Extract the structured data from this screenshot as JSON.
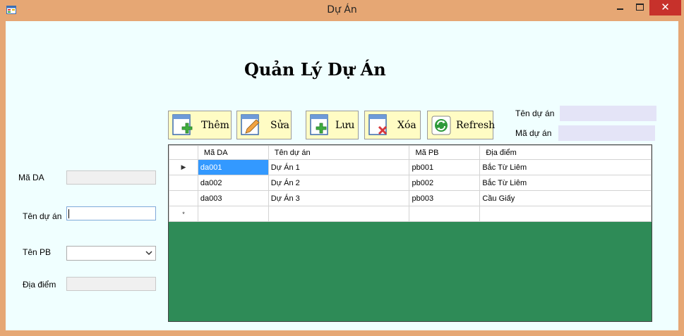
{
  "window": {
    "title": "Dự Án",
    "close_glyph": "✕",
    "icon": "form-icon"
  },
  "heading": "Quản Lý Dự Án",
  "form": {
    "ma_da_label": "Mã DA",
    "ten_du_an_label": "Tên dự án",
    "ten_pb_label": "Tên PB",
    "dia_diem_label": "Địa điểm",
    "ma_da_value": "",
    "ten_du_an_value": "",
    "ten_pb_value": "",
    "dia_diem_value": ""
  },
  "toolbar": {
    "them": "Thêm",
    "sua": "Sửa",
    "luu": "Lưu",
    "xoa": "Xóa",
    "refresh": "Refresh"
  },
  "search": {
    "ten_du_an_label": "Tên dự án",
    "ma_du_an_label": "Mã dự án",
    "ten_du_an_value": "",
    "ma_du_an_value": ""
  },
  "grid": {
    "columns": [
      "Mã DA",
      "Tên dự án",
      "Mã PB",
      "Địa điểm"
    ],
    "rows": [
      [
        "da001",
        "Dự Án 1",
        "pb001",
        "Bắc Từ Liêm"
      ],
      [
        "da002",
        "Dự Án 2",
        "pb002",
        "Bắc Từ Liêm"
      ],
      [
        "da003",
        "Dự Án 3",
        "pb003",
        "Cầu Giấy"
      ]
    ],
    "current_row_marker": "▶",
    "new_row_marker": "*"
  },
  "colors": {
    "titlebar": "#e6a774",
    "client_bg": "#f0ffff",
    "button_bg": "#fffcc4",
    "grid_bg": "#2e8b57",
    "selection": "#3399ff",
    "close_button": "#c7312b"
  }
}
